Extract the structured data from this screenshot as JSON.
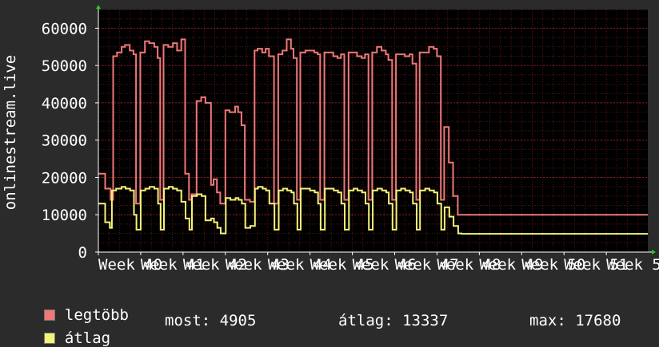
{
  "chart_data": {
    "type": "line",
    "ylabel": "onlinestream.live",
    "ylim": [
      0,
      65000
    ],
    "yticks": [
      0,
      10000,
      20000,
      30000,
      40000,
      50000,
      60000
    ],
    "ytick_labels": [
      "0",
      "10000",
      "20000",
      "30000",
      "40000",
      "50000",
      "60000"
    ],
    "xtick_labels": [
      "Week 40",
      "Week 41",
      "Week 42",
      "Week 43",
      "Week 44",
      "Week 45",
      "Week 46",
      "Week 47",
      "Week 48",
      "Week 49",
      "Week 50",
      "Week 51",
      "Week 5"
    ],
    "x_range": [
      0,
      12.98
    ],
    "grid": true,
    "background": "#000000",
    "grid_color": "#5a1414",
    "series": [
      {
        "name": "legtöbb",
        "color": "#f07878",
        "x": [
          0.0,
          0.16,
          0.29,
          0.35,
          0.44,
          0.55,
          0.63,
          0.74,
          0.83,
          0.89,
          0.99,
          1.1,
          1.2,
          1.32,
          1.4,
          1.46,
          1.54,
          1.65,
          1.76,
          1.86,
          1.96,
          2.05,
          2.14,
          2.2,
          2.32,
          2.43,
          2.53,
          2.66,
          2.72,
          2.8,
          2.88,
          3.0,
          3.1,
          3.23,
          3.3,
          3.38,
          3.46,
          3.58,
          3.69,
          3.76,
          3.87,
          3.95,
          4.03,
          4.15,
          4.25,
          4.35,
          4.45,
          4.55,
          4.61,
          4.69,
          4.77,
          4.89,
          4.99,
          5.1,
          5.18,
          5.24,
          5.34,
          5.45,
          5.55,
          5.65,
          5.73,
          5.81,
          5.91,
          6.02,
          6.11,
          6.22,
          6.3,
          6.38,
          6.47,
          6.58,
          6.69,
          6.79,
          6.85,
          6.94,
          7.03,
          7.14,
          7.24,
          7.35,
          7.42,
          7.51,
          7.59,
          7.71,
          7.81,
          7.92,
          8.0,
          8.09,
          8.17,
          8.28,
          8.38,
          8.49,
          8.57,
          8.65,
          8.75,
          8.87,
          8.96,
          9.07,
          9.13,
          9.21,
          9.31,
          9.42,
          9.51,
          9.61,
          9.7,
          9.79,
          9.88,
          9.99,
          10.08,
          10.2,
          10.28,
          10.37,
          10.45,
          10.56,
          10.66,
          10.76,
          10.86,
          10.94,
          11.04,
          11.14,
          11.24,
          11.35,
          11.43,
          11.52,
          11.6,
          11.7,
          11.8,
          11.89,
          11.98,
          12.07,
          12.24,
          12.45,
          12.7,
          12.98
        ],
        "y": [
          21000,
          17000,
          14000,
          52500,
          53500,
          55000,
          55500,
          54000,
          53000,
          13000,
          53500,
          56500,
          56000,
          55000,
          52000,
          14000,
          55500,
          55000,
          56000,
          54000,
          57000,
          21000,
          14000,
          15500,
          40500,
          41500,
          40000,
          18000,
          19500,
          16000,
          13000,
          38000,
          37500,
          39000,
          37500,
          34000,
          14000,
          13500,
          54000,
          54500,
          53500,
          54500,
          52500,
          13000,
          53000,
          54000,
          57000,
          54500,
          52000,
          14000,
          53500,
          54000,
          54000,
          53500,
          53000,
          14000,
          53500,
          53500,
          52500,
          52000,
          53000,
          14000,
          53500,
          53500,
          52500,
          52000,
          53000,
          14000,
          53500,
          55000,
          54000,
          53000,
          51500,
          14000,
          53000,
          53000,
          52500,
          53000,
          50500,
          14000,
          53500,
          53500,
          55000,
          54500,
          52500,
          14000,
          33500,
          24000,
          15000,
          10000,
          10000,
          10000,
          10000,
          10000,
          10000,
          10000,
          10000,
          10000,
          10000,
          10000,
          10000,
          10000,
          10000,
          10000,
          10000,
          10000,
          10000,
          10000,
          10000,
          10000,
          10000,
          10000,
          10000,
          10000,
          10000,
          10000,
          10000,
          10000,
          10000,
          10000,
          10000,
          10000,
          10000,
          10000,
          10000,
          10000,
          10000,
          10000,
          10000,
          10000,
          10000,
          10000
        ],
        "note": ""
      },
      {
        "name": "átlag",
        "color": "#f4f47a",
        "x": [
          0.0,
          0.16,
          0.27,
          0.32,
          0.42,
          0.55,
          0.64,
          0.75,
          0.84,
          0.9,
          1.0,
          1.11,
          1.21,
          1.32,
          1.41,
          1.47,
          1.55,
          1.66,
          1.76,
          1.86,
          1.96,
          2.06,
          2.15,
          2.21,
          2.33,
          2.44,
          2.53,
          2.66,
          2.73,
          2.81,
          2.89,
          3.01,
          3.12,
          3.24,
          3.31,
          3.39,
          3.47,
          3.59,
          3.7,
          3.77,
          3.88,
          3.96,
          4.04,
          4.16,
          4.26,
          4.36,
          4.46,
          4.56,
          4.62,
          4.7,
          4.78,
          4.9,
          5.0,
          5.11,
          5.19,
          5.25,
          5.35,
          5.46,
          5.56,
          5.66,
          5.74,
          5.82,
          5.92,
          6.03,
          6.12,
          6.23,
          6.31,
          6.39,
          6.48,
          6.59,
          6.7,
          6.8,
          6.86,
          6.95,
          7.04,
          7.15,
          7.25,
          7.36,
          7.43,
          7.52,
          7.6,
          7.72,
          7.82,
          7.93,
          8.01,
          8.1,
          8.18,
          8.29,
          8.39,
          8.5,
          8.58,
          8.66,
          8.76,
          8.88,
          8.97,
          9.08,
          9.14,
          9.22,
          9.32,
          9.43,
          9.52,
          9.62,
          9.71,
          9.8,
          9.89,
          10.0,
          10.09,
          10.21,
          10.29,
          10.38,
          10.46,
          10.57,
          10.67,
          10.77,
          10.87,
          10.95,
          11.05,
          11.15,
          11.25,
          11.36,
          11.44,
          11.53,
          11.61,
          11.71,
          11.81,
          11.9,
          11.99,
          12.08,
          12.25,
          12.46,
          12.71,
          12.98
        ],
        "y": [
          13000,
          8000,
          6500,
          16500,
          17000,
          17500,
          17000,
          16500,
          10000,
          6000,
          16500,
          17000,
          17500,
          17000,
          13000,
          6000,
          17000,
          17500,
          17000,
          16500,
          13500,
          9000,
          6000,
          15000,
          15500,
          15000,
          8500,
          9000,
          8000,
          6500,
          5000,
          14500,
          14000,
          14500,
          14000,
          13000,
          6500,
          7000,
          17000,
          17500,
          17000,
          16500,
          13000,
          6000,
          16500,
          17000,
          16500,
          16000,
          13000,
          6000,
          17000,
          17000,
          16500,
          16000,
          13000,
          6000,
          17000,
          17000,
          16500,
          16000,
          13000,
          6000,
          16500,
          17000,
          16500,
          16000,
          13000,
          6000,
          16500,
          17000,
          16500,
          16000,
          13000,
          6000,
          16500,
          17000,
          16500,
          16000,
          13000,
          6000,
          16500,
          17000,
          16500,
          16000,
          13000,
          6000,
          12000,
          9500,
          7000,
          5000,
          4905,
          4905,
          4905,
          4905,
          4905,
          4905,
          4905,
          4905,
          4905,
          4905,
          4905,
          4905,
          4905,
          4905,
          4905,
          4905,
          4905,
          4905,
          4905,
          4905,
          4905,
          4905,
          4905,
          4905,
          4905,
          4905,
          4905,
          4905,
          4905,
          4905,
          4905,
          4905,
          4905,
          4905,
          4905,
          4905,
          4905,
          4905,
          4905,
          4905,
          4905,
          4905
        ]
      }
    ]
  },
  "legend": {
    "series1_label": "legtöbb",
    "series2_label": "átlag",
    "series1_color": "#f07878",
    "series2_color": "#f4f47a"
  },
  "stats": {
    "most": "most: 4905",
    "atlag": "átlag: 13337",
    "max": "max: 17680"
  }
}
